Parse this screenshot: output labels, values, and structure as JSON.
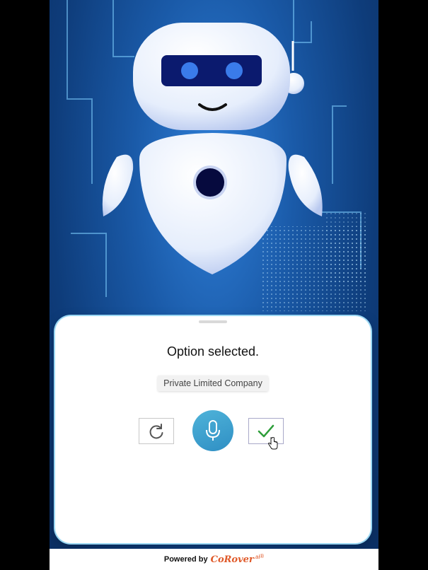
{
  "sheet": {
    "status_text": "Option selected.",
    "selected_option": "Private Limited Company"
  },
  "controls": {
    "retry_icon": "refresh-icon",
    "mic_icon": "microphone-icon",
    "confirm_icon": "checkmark-icon"
  },
  "footer": {
    "powered_by": "Powered by",
    "brand": "CoRover",
    "brand_suffix": ".ai",
    "registered": "®"
  },
  "colors": {
    "mic_accent": "#3aa3d0",
    "check_green": "#2e9e3a",
    "brand_orange": "#e05a2a",
    "robot_eyes": "#3a7bea"
  }
}
